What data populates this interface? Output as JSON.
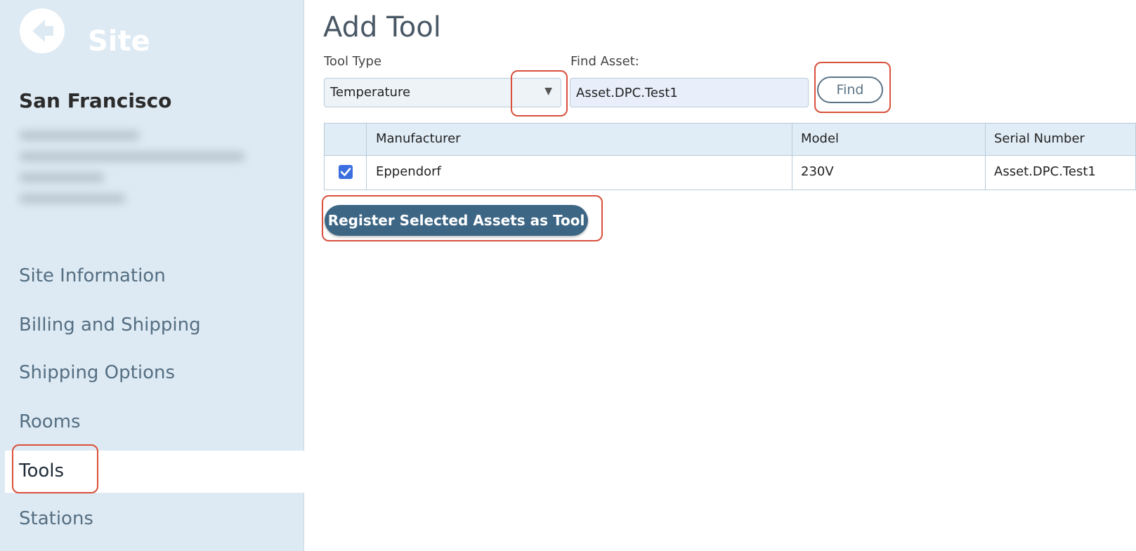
{
  "sidebar": {
    "back_icon": "back-arrow-icon",
    "section_label": "Site",
    "site_name": "San Francisco",
    "items": [
      {
        "label": "Site Information"
      },
      {
        "label": "Billing and Shipping"
      },
      {
        "label": "Shipping Options"
      },
      {
        "label": "Rooms"
      },
      {
        "label": "Tools",
        "active": true
      },
      {
        "label": "Stations"
      }
    ]
  },
  "main": {
    "title": "Add Tool",
    "tool_type": {
      "label": "Tool Type",
      "value": "Temperature"
    },
    "find_asset": {
      "label": "Find Asset:",
      "value": "Asset.DPC.Test1"
    },
    "find_button": "Find",
    "table": {
      "headers": [
        "",
        "Manufacturer",
        "Model",
        "Serial Number"
      ],
      "rows": [
        {
          "checked": true,
          "manufacturer": "Eppendorf",
          "model": "230V",
          "serial": "Asset.DPC.Test1"
        }
      ]
    },
    "register_button": "Register Selected Assets as Tool"
  },
  "colors": {
    "sidebar_bg": "#deeaf3",
    "accent": "#3d6685",
    "highlight": "#d9503c",
    "checkbox": "#3b6fe0"
  }
}
